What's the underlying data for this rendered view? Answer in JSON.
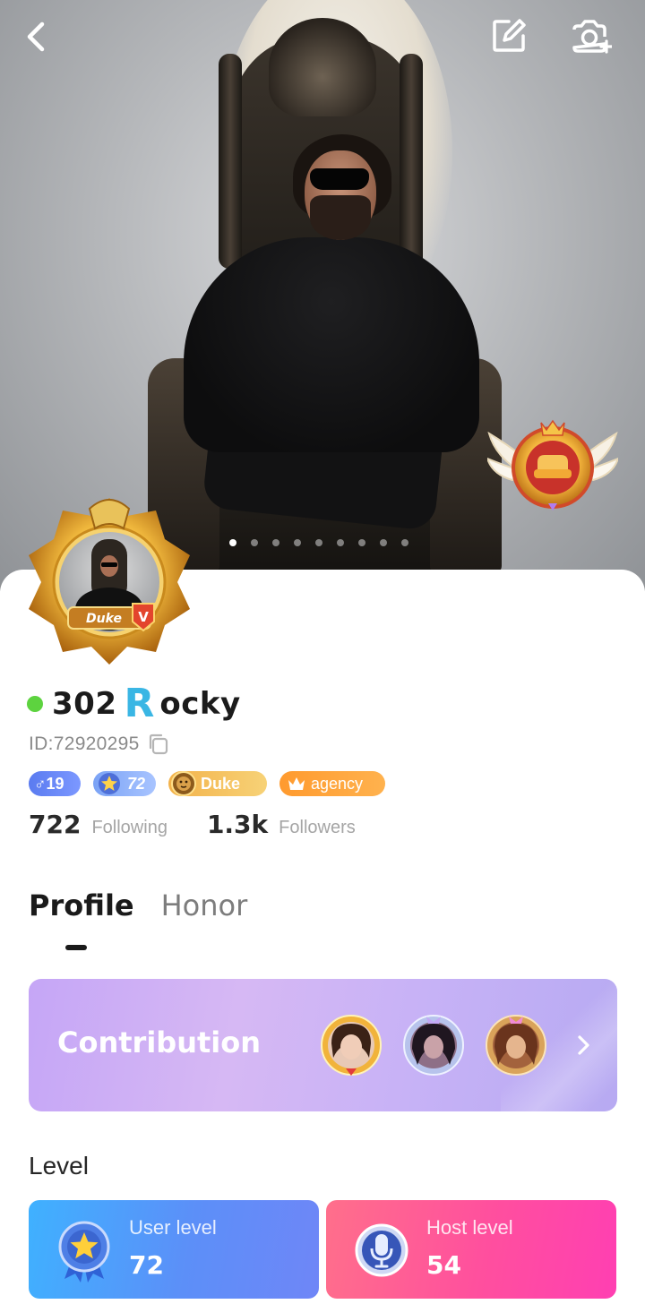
{
  "header": {
    "back_icon": "chevron-left-icon",
    "edit_icon": "edit-icon",
    "camera_icon": "camera-add-icon"
  },
  "carousel": {
    "total": 9,
    "active": 0
  },
  "profile": {
    "online": true,
    "name_prefix": "302",
    "name_letter": "R",
    "name_suffix": "ocky",
    "id_text": "ID:72920295",
    "frame_label": "Duke",
    "frame_badge": "V"
  },
  "tags": {
    "gender_age": "♂19",
    "level": "72",
    "rank": "Duke",
    "agency": "agency"
  },
  "stats": {
    "following_count": "722",
    "following_label": "Following",
    "followers_count": "1.3k",
    "followers_label": "Followers"
  },
  "tabs": {
    "profile": "Profile",
    "honor": "Honor",
    "active": "profile"
  },
  "contribution": {
    "title": "Contribution"
  },
  "level": {
    "heading": "Level",
    "user_label": "User level",
    "user_value": "72",
    "host_label": "Host level",
    "host_value": "54"
  },
  "colors": {
    "online": "#5dd33f",
    "name_letter": "#3ab6e4",
    "user_card": "#5c8ff8",
    "host_card": "#ff4f9e",
    "contribution_card": "#d6b8f4"
  }
}
